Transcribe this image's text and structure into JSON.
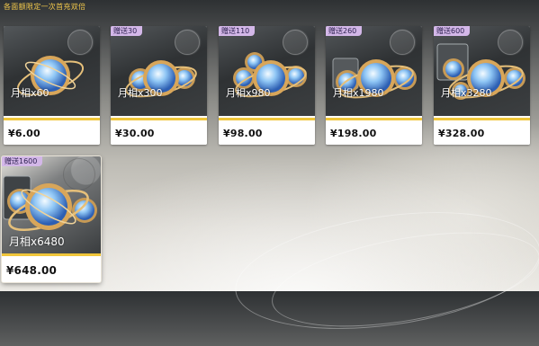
{
  "header": {
    "text": "各面额限定一次首充双倍"
  },
  "products": [
    {
      "amount": "月相x60",
      "price": "¥6.00",
      "badge": ""
    },
    {
      "amount": "月相x300",
      "price": "¥30.00",
      "badge": "赠送30"
    },
    {
      "amount": "月相x980",
      "price": "¥98.00",
      "badge": "赠送110"
    },
    {
      "amount": "月相x1980",
      "price": "¥198.00",
      "badge": "赠送260"
    },
    {
      "amount": "月相x3280",
      "price": "¥328.00",
      "badge": "赠送600"
    },
    {
      "amount": "月相x6480",
      "price": "¥648.00",
      "badge": "赠送1600"
    }
  ],
  "colors": {
    "accent": "#f0c63a",
    "badge_bg": "#d3b7e8",
    "header_text": "#f2c84b"
  },
  "icons": {
    "item": "moon-orb-icon"
  }
}
